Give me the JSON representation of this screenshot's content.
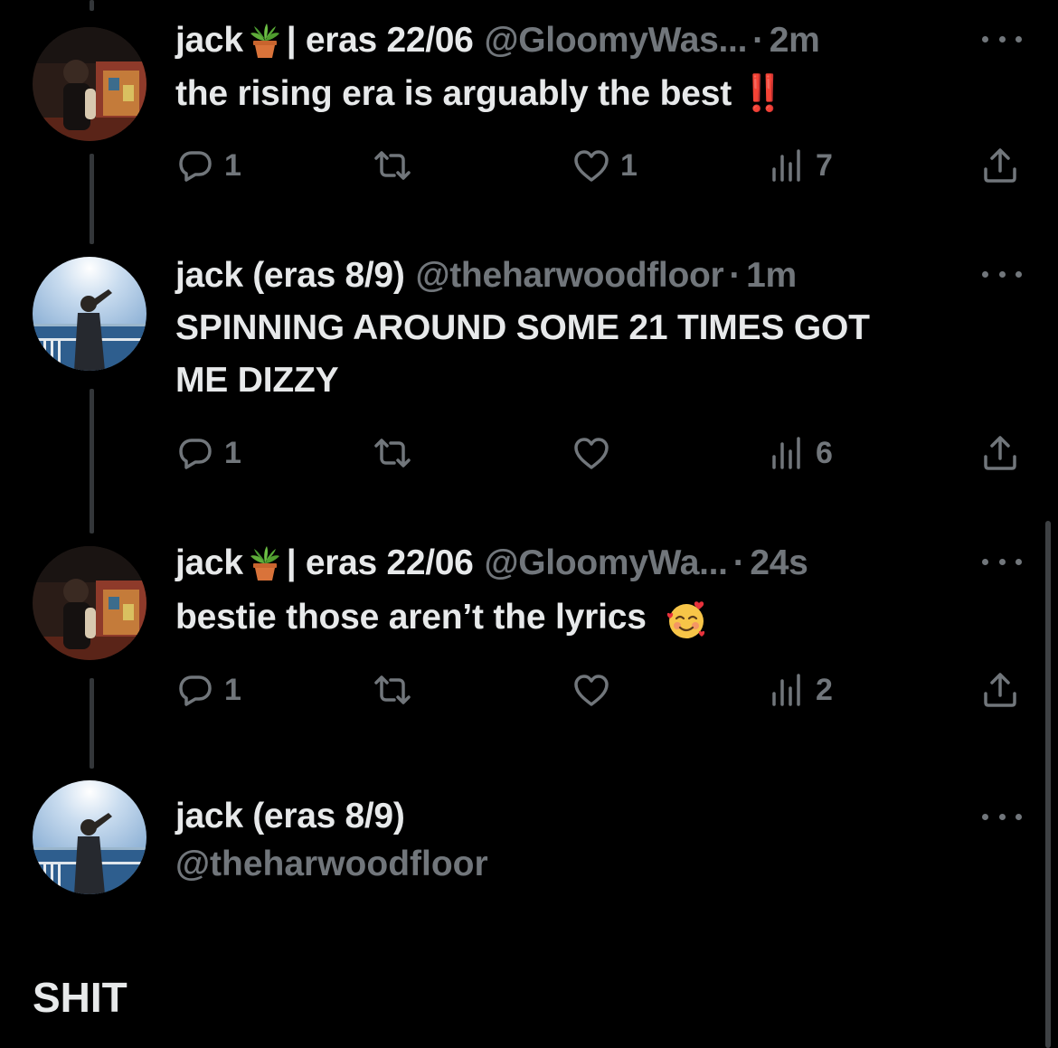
{
  "tweets": [
    {
      "name": "jack",
      "name_suffix": "| eras 22/06",
      "handle": "@GloomyWas...",
      "dot": "·",
      "time": "2m",
      "text": "the rising era is arguably the best",
      "text_emoji": "‼️",
      "reply_count": "1",
      "retweet_count": "",
      "like_count": "1",
      "view_count": "7"
    },
    {
      "name": "jack (eras 8/9)",
      "handle": "@theharwoodfloor",
      "dot": "·",
      "time": "1m",
      "text_line1": "SPINNING AROUND SOME 21 TIMES GOT",
      "text_line2": "ME DIZZY",
      "reply_count": "1",
      "retweet_count": "",
      "like_count": "",
      "view_count": "6"
    },
    {
      "name": "jack",
      "name_suffix": "| eras 22/06",
      "handle": "@GloomyWa...",
      "dot": "·",
      "time": "24s",
      "text": "bestie those aren’t the lyrics",
      "reply_count": "1",
      "retweet_count": "",
      "like_count": "",
      "view_count": "2"
    },
    {
      "name": "jack (eras 8/9)",
      "handle": "@theharwoodfloor",
      "text": "SHIT"
    }
  ],
  "icons": {
    "reply": "reply-icon",
    "retweet": "retweet-icon",
    "like": "like-icon",
    "views": "views-icon",
    "share": "share-icon",
    "more": "more-icon",
    "plant": "potted-plant-emoji",
    "smiling_hearts": "smiling-face-with-hearts-emoji"
  },
  "colors": {
    "background": "#000000",
    "primary_text": "#e7e9ea",
    "secondary_text": "#71767b",
    "thread_line": "#333639",
    "exclamation": "#e0302a"
  }
}
